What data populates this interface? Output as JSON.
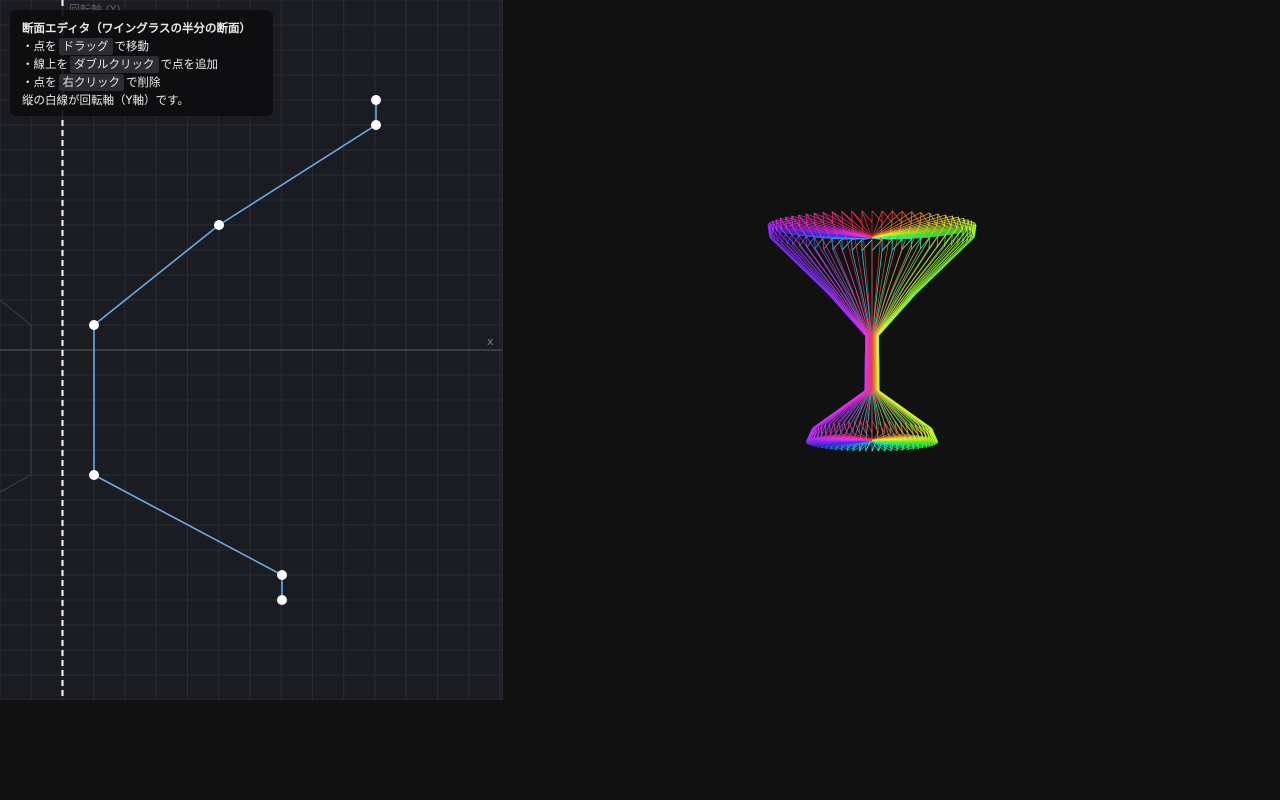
{
  "editor": {
    "axis_label": "回転軸 (Y)",
    "x_label": "x",
    "help": {
      "title": "断面エディタ（ワイングラスの半分の断面）",
      "rows": [
        {
          "prefix": "・点を",
          "key": "ドラッグ",
          "suffix": "で移動"
        },
        {
          "prefix": "・線上を",
          "key": "ダブルクリック",
          "suffix": "で点を追加"
        },
        {
          "prefix": "・点を",
          "key": "右クリック",
          "suffix": "で削除"
        }
      ],
      "footer": "縦の白線が回転軸（Y軸）です。"
    }
  },
  "viewport": {
    "model": "wireframe-wine-glass",
    "coloring": "rainbow"
  },
  "colors": {
    "profile_line": "#6aa8e8",
    "point": "#ffffff",
    "axis_line": "#ffffff",
    "grid": "#2a2c34"
  }
}
